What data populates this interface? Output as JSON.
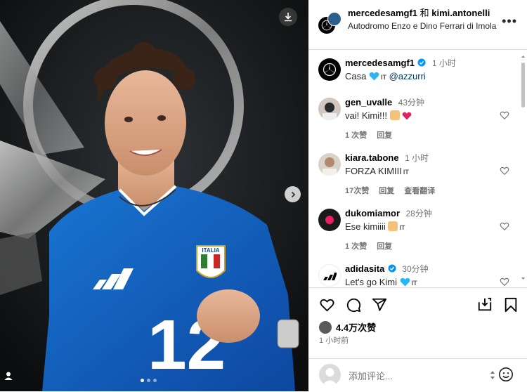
{
  "header": {
    "user1": "mercedesamgf1",
    "connector": "和",
    "user2": "kimi.antonelli",
    "location": "Autodromo Enzo e Dino Ferrari di Imola",
    "more": "•••"
  },
  "caption": {
    "user": "mercedesamgf1",
    "time": "1 小时",
    "text_before": "Casa",
    "lang": "IT",
    "mention": "@azzurri"
  },
  "comments": [
    {
      "user": "gen_uvalle",
      "time": "43分钟",
      "text": "vai! Kimi!!!",
      "likes": "1 次赞",
      "reply": "回复",
      "translate": ""
    },
    {
      "user": "kiara.tabone",
      "time": "1 小时",
      "text": "FORZA KIMIII",
      "lang": "IT",
      "likes": "17次赞",
      "reply": "回复",
      "translate": "查看翻译"
    },
    {
      "user": "dukomiamor",
      "time": "28分钟",
      "text": "Ese kimiiii",
      "lang": "IT",
      "likes": "1 次赞",
      "reply": "回复",
      "translate": ""
    },
    {
      "user": "adidasita",
      "time": "30分钟",
      "text": "Let's go Kimi",
      "lang": "IT",
      "likes": "",
      "reply": "",
      "translate": ""
    }
  ],
  "footer": {
    "likes": "4.4万次赞",
    "ago": "1 小时前",
    "comment_placeholder": "添加评论..."
  },
  "photo": {
    "jersey_number": "12",
    "badge_text": "ITALIA"
  },
  "colors": {
    "blue_check": "#0095f6",
    "heart_red": "#e0245e",
    "jersey_blue": "#1565c0"
  }
}
